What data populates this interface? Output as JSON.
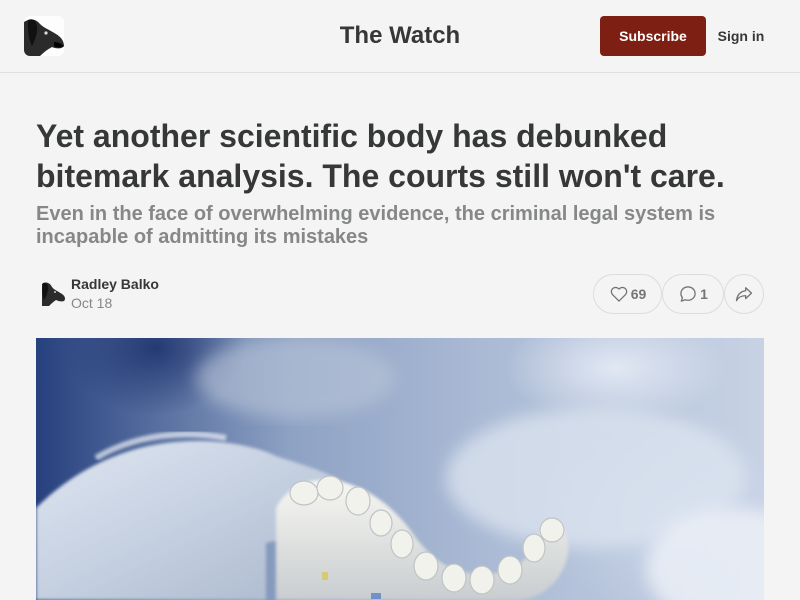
{
  "header": {
    "publication_title": "The Watch",
    "subscribe_label": "Subscribe",
    "signin_label": "Sign in",
    "logo_icon": "dog-portrait-logo"
  },
  "article": {
    "title": "Yet another scientific body has debunked bitemark analysis. The courts still won't care.",
    "subtitle": "Even in the face of overwhelming evidence, the criminal legal system is incapable of admitting its mistakes",
    "author": "Radley Balko",
    "date": "Oct 18",
    "likes": "69",
    "comments": "1",
    "icons": {
      "like": "heart-icon",
      "comment": "comment-bubble-icon",
      "share": "share-arrow-icon"
    }
  },
  "hero_image": {
    "subject": "gloved-hand-holding-dental-mold"
  },
  "colors": {
    "background": "#f4f4f4",
    "accent": "#7d1f12",
    "text": "#363737",
    "muted_text": "#868787"
  }
}
